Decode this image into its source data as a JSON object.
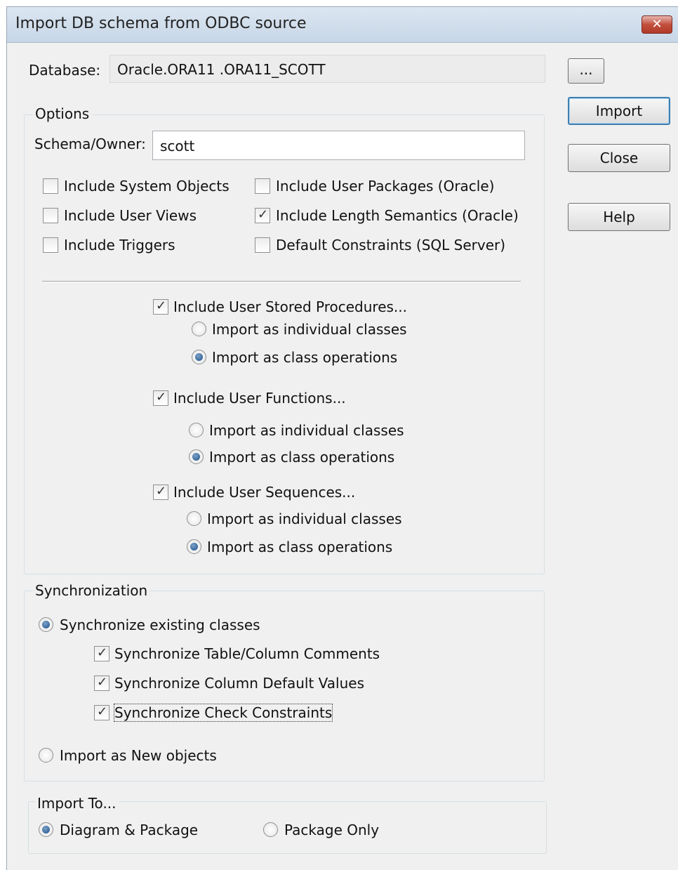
{
  "window": {
    "title": "Import DB schema from ODBC source"
  },
  "database": {
    "label": "Database:",
    "value": "Oracle.ORA11 .ORA11_SCOTT",
    "browse_label": "..."
  },
  "buttons": {
    "import": "Import",
    "close": "Close",
    "help": "Help"
  },
  "options": {
    "group_label": "Options",
    "schema_label": "Schema/Owner:",
    "schema_value": "scott",
    "checks": [
      {
        "label": "Include System Objects",
        "checked": false
      },
      {
        "label": "Include User Views",
        "checked": false
      },
      {
        "label": "Include Triggers",
        "checked": false
      },
      {
        "label": "Include User Packages (Oracle)",
        "checked": false
      },
      {
        "label": "Include Length Semantics (Oracle)",
        "checked": true
      },
      {
        "label": "Default Constraints (SQL Server)",
        "checked": false
      }
    ],
    "stored_procedures": {
      "label": "Include User Stored Procedures...",
      "checked": true,
      "opt_individual": "Import as individual classes",
      "opt_operations": "Import as class operations",
      "selected": "operations"
    },
    "functions": {
      "label": "Include User Functions...",
      "checked": true,
      "opt_individual": "Import as individual classes",
      "opt_operations": "Import as class operations",
      "selected": "operations"
    },
    "sequences": {
      "label": "Include User Sequences...",
      "checked": true,
      "opt_individual": "Import as individual classes",
      "opt_operations": "Import as class operations",
      "selected": "operations"
    }
  },
  "synchronization": {
    "group_label": "Synchronization",
    "sync_existing": "Synchronize existing classes",
    "sync_comments": "Synchronize Table/Column Comments",
    "sync_defaults": "Synchronize Column Default Values",
    "sync_constraints": "Synchronize Check Constraints",
    "import_new": "Import as New objects",
    "selected": "sync_existing"
  },
  "import_to": {
    "group_label": "Import To...",
    "diagram_package": "Diagram & Package",
    "package_only": "Package Only",
    "selected": "diagram_package"
  }
}
